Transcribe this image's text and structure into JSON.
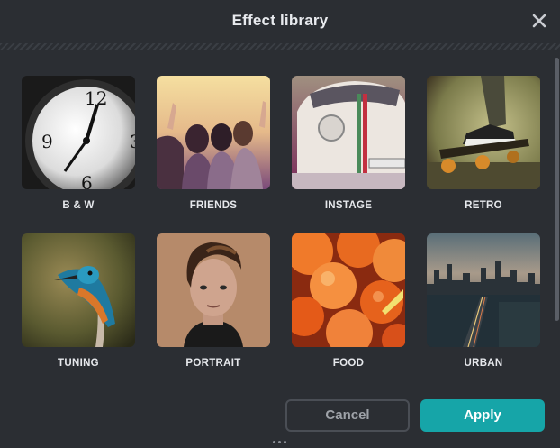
{
  "dialog": {
    "title": "Effect library",
    "close_icon": "close-icon"
  },
  "effects": [
    {
      "label": "B & W",
      "image": "clock-photo"
    },
    {
      "label": "FRIENDS",
      "image": "friends-photo"
    },
    {
      "label": "INSTAGE",
      "image": "car-photo"
    },
    {
      "label": "RETRO",
      "image": "skateboard-photo"
    },
    {
      "label": "TUNING",
      "image": "kingfisher-photo"
    },
    {
      "label": "PORTRAIT",
      "image": "portrait-photo"
    },
    {
      "label": "FOOD",
      "image": "peaches-photo"
    },
    {
      "label": "URBAN",
      "image": "city-photo"
    }
  ],
  "footer": {
    "cancel_label": "Cancel",
    "apply_label": "Apply"
  },
  "colors": {
    "background": "#2b2e33",
    "accent": "#16a5a8"
  }
}
